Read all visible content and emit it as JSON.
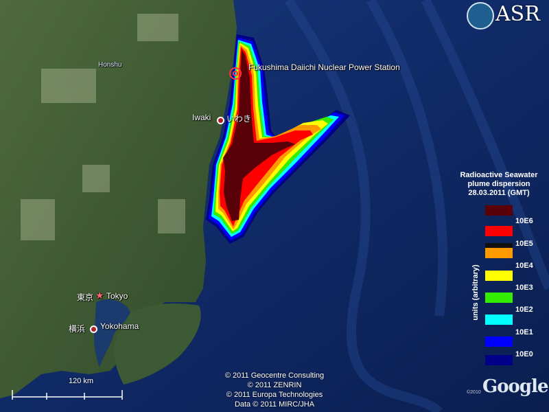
{
  "branding": {
    "asr_text": "ASR",
    "google_text": "Google",
    "google_copyright": "©2010"
  },
  "places": {
    "honshu": "Honshu",
    "fukushima": "Fukushima Daiichi Nuclear Power Station",
    "iwaki": "Iwaki",
    "iwaki_jp": "いわき",
    "tokyo_jp": "東京",
    "tokyo": "Tokyo",
    "yokohama_jp": "横浜",
    "yokohama": "Yokohama"
  },
  "legend": {
    "title_line1": "Radioactive Seawater",
    "title_line2": "plume dispersion",
    "title_line3": "28.03.2011 (GMT)",
    "axis_label": "units (arbitrary)",
    "swatches": [
      "#5a0008",
      "#ff0000",
      "#111111",
      "#ff9900",
      "#ffff00",
      "#33ee00",
      "#00ffff",
      "#0000ff",
      "#000088"
    ],
    "ticks": [
      "10E6",
      "10E5",
      "10E4",
      "10E3",
      "10E2",
      "10E1",
      "10E0"
    ]
  },
  "scale": {
    "label": "120 km"
  },
  "credits": [
    "© 2011 Geocentre Consulting",
    "© 2011 ZENRIN",
    "© 2011 Europa Technologies",
    "Data © 2011 MIRC/JHA"
  ]
}
